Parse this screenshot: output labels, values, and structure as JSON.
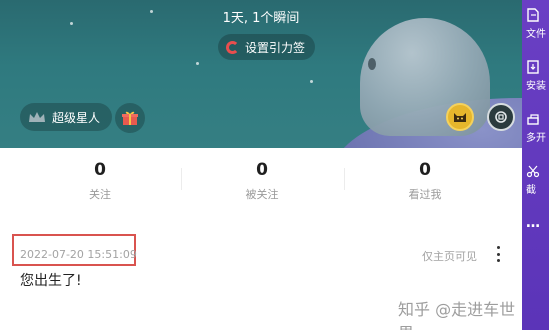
{
  "hero": {
    "summary": "1天, 1个瞬间",
    "signature_label": "设置引力签",
    "vip_label": "超级星人"
  },
  "stats": [
    {
      "value": "0",
      "label": "关注"
    },
    {
      "value": "0",
      "label": "被关注"
    },
    {
      "value": "0",
      "label": "看过我"
    }
  ],
  "post": {
    "timestamp": "2022-07-20 15:51:09",
    "visibility": "仅主页可见",
    "text": "您出生了!"
  },
  "watermark": "知乎 @走进车世界",
  "side_rail": {
    "items": [
      {
        "label": "文件",
        "icon": "file-icon"
      },
      {
        "label": "安装",
        "icon": "install-icon"
      },
      {
        "label": "多开",
        "icon": "multi-open-icon"
      },
      {
        "label": "截",
        "icon": "scissors-icon"
      },
      {
        "label": "…",
        "icon": "more-icon"
      }
    ]
  },
  "colors": {
    "hero_bg": "#2f7a7f",
    "side_rail": "#5b34b8",
    "highlight_box": "#d9534f"
  }
}
